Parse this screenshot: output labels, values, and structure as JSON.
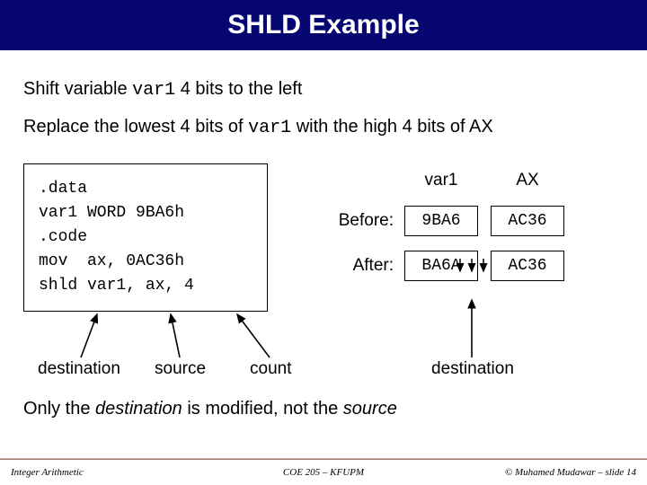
{
  "title": "SHLD Example",
  "line1_pre": "Shift variable ",
  "line1_code": "var1",
  "line1_post": " 4 bits to the left",
  "line2_pre": "Replace the lowest 4 bits of ",
  "line2_code": "var1",
  "line2_post": " with the high 4 bits of AX",
  "code": ".data\nvar1 WORD 9BA6h\n.code\nmov  ax, 0AC36h\nshld var1, ax, 4",
  "table": {
    "col1": "var1",
    "col2": "AX",
    "row1": "Before:",
    "row2": "After:",
    "c11": "9BA6",
    "c12": "AC36",
    "c21": "BA6A",
    "c22": "AC36"
  },
  "annot": {
    "dest1": "destination",
    "source": "source",
    "count": "count",
    "dest2": "destination"
  },
  "only_pre": "Only the ",
  "only_em1": "destination",
  "only_mid": " is modified, not the ",
  "only_em2": "source",
  "footer": {
    "left": "Integer Arithmetic",
    "center": "COE 205 – KFUPM",
    "right": "© Muhamed Mudawar – slide 14"
  }
}
